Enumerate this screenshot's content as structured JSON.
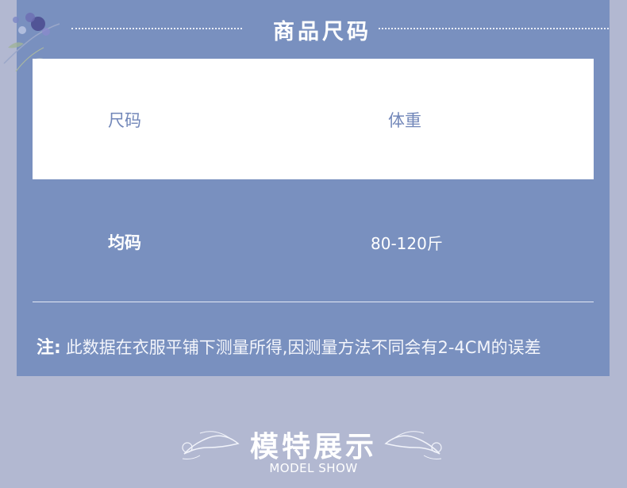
{
  "header": {
    "title": "商品尺码"
  },
  "table": {
    "headers": [
      "尺码",
      "体重"
    ],
    "rows": [
      [
        "均码",
        "80-120斤"
      ]
    ]
  },
  "note": {
    "label": "注:",
    "text": "此数据在衣服平铺下测量所得,因测量方法不同会有2-4CM的误差"
  },
  "model_section": {
    "title": "模特展示",
    "subtitle": "MODEL SHOW"
  },
  "colors": {
    "page_bg": "#b2b8d1",
    "panel": "#7990bf",
    "accent_text": "#7287b9"
  }
}
